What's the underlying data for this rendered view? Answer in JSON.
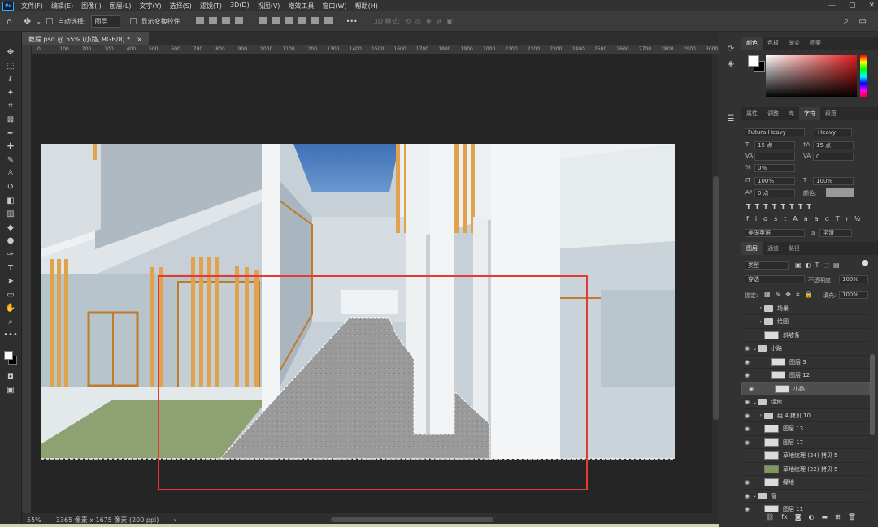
{
  "app": {
    "logo": "Ps",
    "menu": [
      "文件(F)",
      "编辑(E)",
      "图像(I)",
      "图层(L)",
      "文字(Y)",
      "选择(S)",
      "滤镜(T)",
      "3D(D)",
      "视图(V)",
      "增效工具",
      "窗口(W)",
      "帮助(H)"
    ]
  },
  "window": {
    "minimize": "—",
    "maximize": "▢",
    "close": "✕"
  },
  "options": {
    "auto_select": "自动选择:",
    "auto_select_value": "图层",
    "transform_controls": "显示变换控件",
    "mode_3d": "3D 模式:",
    "more": "•••"
  },
  "document": {
    "tab_title": "教程.psd @ 55% (小路, RGB/8) *",
    "tab_close": "×"
  },
  "ruler": {
    "marks": [
      "0",
      "100",
      "200",
      "300",
      "400",
      "500",
      "600",
      "700",
      "800",
      "900",
      "1000",
      "1100",
      "1200",
      "1300",
      "1400",
      "1500",
      "1600",
      "1700",
      "1800",
      "1900",
      "2000",
      "2100",
      "2200",
      "2300",
      "2400",
      "2500",
      "2600",
      "2700",
      "2800",
      "2900",
      "3000"
    ]
  },
  "status": {
    "zoom": "55%",
    "doc_info": "3365 像素 x 1675 像素 (200 ppi)"
  },
  "color_panel": {
    "tabs": [
      "颜色",
      "色板",
      "渐变",
      "图案"
    ],
    "active": 0,
    "foreground": "#ffffff",
    "background": "#000000"
  },
  "character_panel": {
    "tabs": [
      "属性",
      "调整",
      "库",
      "字符",
      "段落"
    ],
    "active": 3,
    "font": "Futura Heavy",
    "style": "Heavy",
    "size": "15 点",
    "leading": "15 点",
    "kerning": "",
    "tracking": "0",
    "scale_pct": "0%",
    "v_scale": "100%",
    "h_scale": "100%",
    "baseline": "0 点",
    "color_label": "颜色:",
    "language": "美国英语",
    "aa": "a",
    "aa_mode": "平滑"
  },
  "layers_panel": {
    "tabs": [
      "图层",
      "通道",
      "路径"
    ],
    "active": 0,
    "filter": "类型",
    "blend": "穿透",
    "opacity_label": "不透明度:",
    "opacity": "100%",
    "lock_label": "锁定:",
    "fill_label": "填充:",
    "fill": "100%",
    "layers": [
      {
        "name": "场景",
        "type": "folder",
        "visible": false,
        "indent": 1
      },
      {
        "name": "绘图",
        "type": "folder",
        "visible": false,
        "indent": 1
      },
      {
        "name": "斜坡条",
        "type": "layer",
        "visible": false,
        "indent": 1
      },
      {
        "name": "小路",
        "type": "folder",
        "visible": true,
        "indent": 0,
        "open": true
      },
      {
        "name": "图层 3",
        "type": "layer",
        "visible": true,
        "indent": 2
      },
      {
        "name": "图层 12",
        "type": "layer",
        "visible": true,
        "indent": 2
      },
      {
        "name": "小路",
        "type": "layer",
        "visible": true,
        "indent": 2,
        "selected": true
      },
      {
        "name": "绿地",
        "type": "folder",
        "visible": true,
        "indent": 0,
        "open": true
      },
      {
        "name": "组 4 拷贝 10",
        "type": "folder",
        "visible": true,
        "indent": 1
      },
      {
        "name": "图层 13",
        "type": "layer",
        "visible": true,
        "indent": 1
      },
      {
        "name": "图层 17",
        "type": "layer",
        "visible": true,
        "indent": 1
      },
      {
        "name": "草地纹理 (24) 拷贝 5",
        "type": "layer",
        "visible": false,
        "indent": 1
      },
      {
        "name": "草地纹理 (22) 拷贝 5",
        "type": "layer",
        "visible": false,
        "indent": 1,
        "green": true
      },
      {
        "name": "绿地",
        "type": "layer",
        "visible": true,
        "indent": 1
      },
      {
        "name": "窗",
        "type": "folder",
        "visible": true,
        "indent": 0,
        "open": true
      },
      {
        "name": "图层 11",
        "type": "layer",
        "visible": true,
        "indent": 1
      }
    ],
    "footer_icons": [
      "link-icon",
      "fx-icon",
      "mask-icon",
      "adjustment-icon",
      "group-icon",
      "new-layer-icon",
      "trash-icon"
    ]
  }
}
